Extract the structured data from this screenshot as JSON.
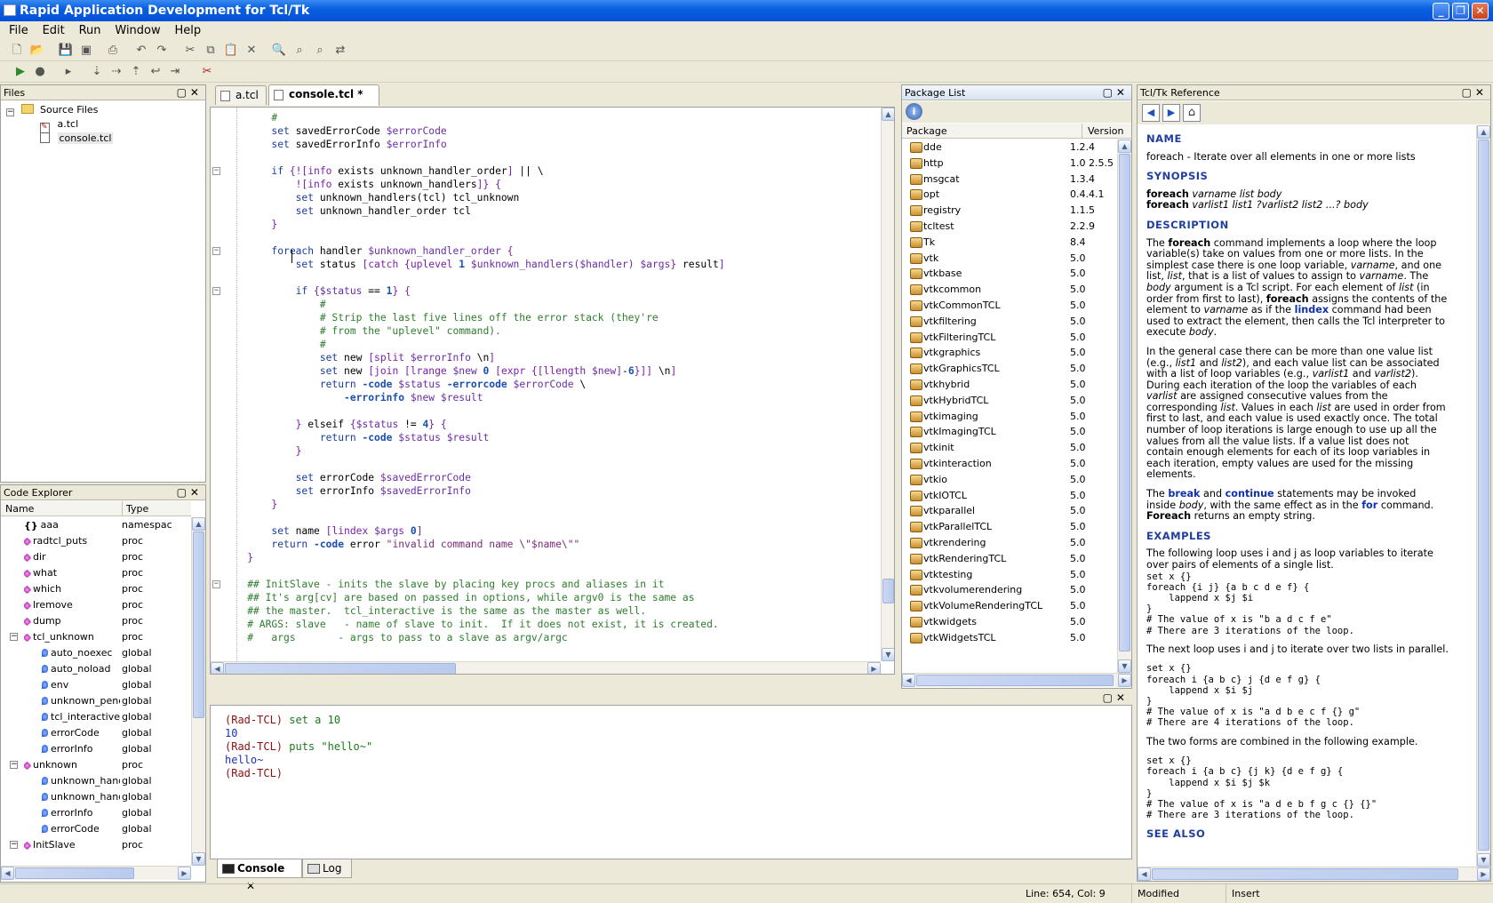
{
  "window": {
    "title": "Rapid Application Development for Tcl/Tk"
  },
  "menu": [
    "File",
    "Edit",
    "Run",
    "Window",
    "Help"
  ],
  "files_panel": {
    "title": "Files",
    "root": "Source Files",
    "items": [
      "a.tcl",
      "console.tcl"
    ]
  },
  "code_explorer": {
    "title": "Code Explorer",
    "columns": [
      "Name",
      "Type"
    ],
    "rows": [
      {
        "name": "aaa",
        "type": "namespac",
        "kind": "ns",
        "level": 0
      },
      {
        "name": "radtcl_puts",
        "type": "proc",
        "kind": "proc",
        "level": 0
      },
      {
        "name": "dir",
        "type": "proc",
        "kind": "proc",
        "level": 0
      },
      {
        "name": "what",
        "type": "proc",
        "kind": "proc",
        "level": 0
      },
      {
        "name": "which",
        "type": "proc",
        "kind": "proc",
        "level": 0
      },
      {
        "name": "lremove",
        "type": "proc",
        "kind": "proc",
        "level": 0
      },
      {
        "name": "dump",
        "type": "proc",
        "kind": "proc",
        "level": 0
      },
      {
        "name": "tcl_unknown",
        "type": "proc",
        "kind": "proc",
        "level": 0,
        "expanded": true
      },
      {
        "name": "auto_noexec",
        "type": "global",
        "kind": "glob",
        "level": 1
      },
      {
        "name": "auto_noload",
        "type": "global",
        "kind": "glob",
        "level": 1
      },
      {
        "name": "env",
        "type": "global",
        "kind": "glob",
        "level": 1
      },
      {
        "name": "unknown_pending",
        "type": "global",
        "kind": "glob",
        "level": 1
      },
      {
        "name": "tcl_interactive",
        "type": "global",
        "kind": "glob",
        "level": 1
      },
      {
        "name": "errorCode",
        "type": "global",
        "kind": "glob",
        "level": 1
      },
      {
        "name": "errorInfo",
        "type": "global",
        "kind": "glob",
        "level": 1
      },
      {
        "name": "unknown",
        "type": "proc",
        "kind": "proc",
        "level": 0,
        "expanded": true
      },
      {
        "name": "unknown_handlers",
        "type": "global",
        "kind": "glob",
        "level": 1
      },
      {
        "name": "unknown_handler_order",
        "type": "global",
        "kind": "glob",
        "level": 1
      },
      {
        "name": "errorInfo",
        "type": "global",
        "kind": "glob",
        "level": 1
      },
      {
        "name": "errorCode",
        "type": "global",
        "kind": "glob",
        "level": 1
      },
      {
        "name": "InitSlave",
        "type": "proc",
        "kind": "proc",
        "level": 0,
        "expanded": true
      }
    ]
  },
  "editor": {
    "tabs": [
      {
        "label": "a.tcl",
        "active": false
      },
      {
        "label": "console.tcl *",
        "active": true
      }
    ],
    "lines": [
      {
        "t": [
          [
            "",
            "        #"
          ]
        ],
        "cm": true
      },
      {
        "t": [
          [
            "kw",
            "        set"
          ],
          [
            "",
            " savedErrorCode "
          ],
          [
            "var",
            "$errorCode"
          ]
        ]
      },
      {
        "t": [
          [
            "kw",
            "        set"
          ],
          [
            "",
            " savedErrorInfo "
          ],
          [
            "var",
            "$errorInfo"
          ]
        ]
      },
      {
        "t": [
          [
            "",
            ""
          ]
        ]
      },
      {
        "t": [
          [
            "kw",
            "        if"
          ],
          [
            "",
            " "
          ],
          [
            "br",
            "{![info"
          ],
          [
            "",
            " exists unknown_handler_order"
          ],
          [
            "br",
            "]"
          ],
          [
            "",
            " || \\"
          ]
        ],
        "fold": true
      },
      {
        "t": [
          [
            "br",
            "            ![info"
          ],
          [
            "",
            " exists unknown_handlers"
          ],
          [
            "br",
            "]}"
          ],
          [
            "",
            " "
          ],
          [
            "br",
            "{"
          ]
        ]
      },
      {
        "t": [
          [
            "kw",
            "            set"
          ],
          [
            "",
            " unknown_handlers(tcl) tcl_unknown"
          ]
        ]
      },
      {
        "t": [
          [
            "kw",
            "            set"
          ],
          [
            "",
            " unknown_handler_order tcl"
          ]
        ]
      },
      {
        "t": [
          [
            "br",
            "        }"
          ]
        ]
      },
      {
        "t": [
          [
            "",
            ""
          ]
        ]
      },
      {
        "t": [
          [
            "kw",
            "        foreach"
          ],
          [
            "",
            " handler "
          ],
          [
            "var",
            "$unknown_handler_order"
          ],
          [
            "",
            " "
          ],
          [
            "br",
            "{"
          ]
        ],
        "fold": true
      },
      {
        "t": [
          [
            "kw",
            "            set"
          ],
          [
            "",
            " status "
          ],
          [
            "br",
            "[catch {uplevel"
          ],
          [
            "",
            " "
          ],
          [
            "sw",
            "1"
          ],
          [
            "",
            " "
          ],
          [
            "var",
            "$unknown_handlers($handler)"
          ],
          [
            "",
            " "
          ],
          [
            "var",
            "$args"
          ],
          [
            "br",
            "}"
          ],
          [
            "",
            " result"
          ],
          [
            "br",
            "]"
          ]
        ]
      },
      {
        "t": [
          [
            "",
            ""
          ]
        ]
      },
      {
        "t": [
          [
            "kw",
            "            if"
          ],
          [
            "",
            " "
          ],
          [
            "br",
            "{"
          ],
          [
            "var",
            "$status"
          ],
          [
            "",
            " == "
          ],
          [
            "sw",
            "1"
          ],
          [
            "br",
            "}"
          ],
          [
            "",
            " "
          ],
          [
            "br",
            "{"
          ]
        ],
        "fold": true
      },
      {
        "t": [
          [
            "cm",
            "                #"
          ]
        ]
      },
      {
        "t": [
          [
            "cm",
            "                # Strip the last five lines off the error stack (they're"
          ]
        ]
      },
      {
        "t": [
          [
            "cm",
            "                # from the \"uplevel\" command)."
          ]
        ]
      },
      {
        "t": [
          [
            "cm",
            "                #"
          ]
        ]
      },
      {
        "t": [
          [
            "kw",
            "                set"
          ],
          [
            "",
            " new "
          ],
          [
            "br",
            "[split"
          ],
          [
            "",
            " "
          ],
          [
            "var",
            "$errorInfo"
          ],
          [
            "",
            " \\n"
          ],
          [
            "br",
            "]"
          ]
        ]
      },
      {
        "t": [
          [
            "kw",
            "                set"
          ],
          [
            "",
            " new "
          ],
          [
            "br",
            "[join [lrange"
          ],
          [
            "",
            " "
          ],
          [
            "var",
            "$new"
          ],
          [
            "",
            " "
          ],
          [
            "sw",
            "0"
          ],
          [
            "",
            " "
          ],
          [
            "br",
            "[expr {[llength"
          ],
          [
            "",
            " "
          ],
          [
            "var",
            "$new"
          ],
          [
            "br",
            "]"
          ],
          [
            "",
            "-"
          ],
          [
            "sw",
            "6"
          ],
          [
            "br",
            "}]]"
          ],
          [
            "",
            " \\n"
          ],
          [
            "br",
            "]"
          ]
        ]
      },
      {
        "t": [
          [
            "kw",
            "                return"
          ],
          [
            "",
            " "
          ],
          [
            "sw",
            "-code"
          ],
          [
            "",
            " "
          ],
          [
            "var",
            "$status"
          ],
          [
            "",
            " "
          ],
          [
            "sw",
            "-errorcode"
          ],
          [
            "",
            " "
          ],
          [
            "var",
            "$errorCode"
          ],
          [
            "",
            " \\"
          ]
        ]
      },
      {
        "t": [
          [
            "sw",
            "                    -errorinfo"
          ],
          [
            "",
            " "
          ],
          [
            "var",
            "$new"
          ],
          [
            "",
            " "
          ],
          [
            "var",
            "$result"
          ]
        ]
      },
      {
        "t": [
          [
            "",
            ""
          ]
        ]
      },
      {
        "t": [
          [
            "br",
            "            }"
          ],
          [
            "",
            " elseif "
          ],
          [
            "br",
            "{"
          ],
          [
            "var",
            "$status"
          ],
          [
            "",
            " != "
          ],
          [
            "sw",
            "4"
          ],
          [
            "br",
            "}"
          ],
          [
            "",
            " "
          ],
          [
            "br",
            "{"
          ]
        ]
      },
      {
        "t": [
          [
            "kw",
            "                return"
          ],
          [
            "",
            " "
          ],
          [
            "sw",
            "-code"
          ],
          [
            "",
            " "
          ],
          [
            "var",
            "$status"
          ],
          [
            "",
            " "
          ],
          [
            "var",
            "$result"
          ]
        ]
      },
      {
        "t": [
          [
            "br",
            "            }"
          ]
        ]
      },
      {
        "t": [
          [
            "",
            ""
          ]
        ]
      },
      {
        "t": [
          [
            "kw",
            "            set"
          ],
          [
            "",
            " errorCode "
          ],
          [
            "var",
            "$savedErrorCode"
          ]
        ]
      },
      {
        "t": [
          [
            "kw",
            "            set"
          ],
          [
            "",
            " errorInfo "
          ],
          [
            "var",
            "$savedErrorInfo"
          ]
        ]
      },
      {
        "t": [
          [
            "br",
            "        }"
          ]
        ]
      },
      {
        "t": [
          [
            "",
            ""
          ]
        ]
      },
      {
        "t": [
          [
            "kw",
            "        set"
          ],
          [
            "",
            " name "
          ],
          [
            "br",
            "[lindex"
          ],
          [
            "",
            " "
          ],
          [
            "var",
            "$args"
          ],
          [
            "",
            " "
          ],
          [
            "sw",
            "0"
          ],
          [
            "br",
            "]"
          ]
        ]
      },
      {
        "t": [
          [
            "kw",
            "        return"
          ],
          [
            "",
            " "
          ],
          [
            "sw",
            "-code"
          ],
          [
            "",
            " error "
          ],
          [
            "str",
            "\"invalid command name \\\"$name\\\"\""
          ]
        ]
      },
      {
        "t": [
          [
            "br",
            "    }"
          ]
        ]
      },
      {
        "t": [
          [
            "",
            ""
          ]
        ]
      },
      {
        "t": [
          [
            "cm",
            "    ## InitSlave - inits the slave by placing key procs and aliases in it"
          ]
        ],
        "fold": true
      },
      {
        "t": [
          [
            "cm",
            "    ## It's arg[cv] are based on passed in options, while argv0 is the same as"
          ]
        ]
      },
      {
        "t": [
          [
            "cm",
            "    ## the master.  tcl_interactive is the same as the master as well."
          ]
        ]
      },
      {
        "t": [
          [
            "cm",
            "    # ARGS: slave   - name of slave to init.  If it does not exist, it is created."
          ]
        ]
      },
      {
        "t": [
          [
            "cm",
            "    #   args       - args to pass to a slave as argv/argc"
          ]
        ]
      }
    ]
  },
  "package_list": {
    "title": "Package List",
    "columns": [
      "Package",
      "Version"
    ],
    "rows": [
      {
        "name": "dde",
        "version": "1.2.4"
      },
      {
        "name": "http",
        "version": "1.0 2.5.5"
      },
      {
        "name": "msgcat",
        "version": "1.3.4"
      },
      {
        "name": "opt",
        "version": "0.4.4.1"
      },
      {
        "name": "registry",
        "version": "1.1.5"
      },
      {
        "name": "tcltest",
        "version": "2.2.9"
      },
      {
        "name": "Tk",
        "version": "8.4"
      },
      {
        "name": "vtk",
        "version": "5.0"
      },
      {
        "name": "vtkbase",
        "version": "5.0"
      },
      {
        "name": "vtkcommon",
        "version": "5.0"
      },
      {
        "name": "vtkCommonTCL",
        "version": "5.0"
      },
      {
        "name": "vtkfiltering",
        "version": "5.0"
      },
      {
        "name": "vtkFilteringTCL",
        "version": "5.0"
      },
      {
        "name": "vtkgraphics",
        "version": "5.0"
      },
      {
        "name": "vtkGraphicsTCL",
        "version": "5.0"
      },
      {
        "name": "vtkhybrid",
        "version": "5.0"
      },
      {
        "name": "vtkHybridTCL",
        "version": "5.0"
      },
      {
        "name": "vtkimaging",
        "version": "5.0"
      },
      {
        "name": "vtkImagingTCL",
        "version": "5.0"
      },
      {
        "name": "vtkinit",
        "version": "5.0"
      },
      {
        "name": "vtkinteraction",
        "version": "5.0"
      },
      {
        "name": "vtkio",
        "version": "5.0"
      },
      {
        "name": "vtkIOTCL",
        "version": "5.0"
      },
      {
        "name": "vtkparallel",
        "version": "5.0"
      },
      {
        "name": "vtkParallelTCL",
        "version": "5.0"
      },
      {
        "name": "vtkrendering",
        "version": "5.0"
      },
      {
        "name": "vtkRenderingTCL",
        "version": "5.0"
      },
      {
        "name": "vtktesting",
        "version": "5.0"
      },
      {
        "name": "vtkvolumerendering",
        "version": "5.0"
      },
      {
        "name": "vtkVolumeRenderingTCL",
        "version": "5.0"
      },
      {
        "name": "vtkwidgets",
        "version": "5.0"
      },
      {
        "name": "vtkWidgetsTCL",
        "version": "5.0"
      }
    ]
  },
  "reference": {
    "title": "Tcl/Tk Reference",
    "name_heading": "NAME",
    "name_text": "foreach - Iterate over all elements in one or more lists",
    "synopsis_heading": "SYNOPSIS",
    "syn1_cmd": "foreach",
    "syn1_args": "varname list body",
    "syn2_cmd": "foreach",
    "syn2_args": "varlist1 list1 ?varlist2 list2 ...? body",
    "description_heading": "DESCRIPTION",
    "examples_heading": "EXAMPLES",
    "see_also_heading": "SEE ALSO",
    "ex_intro1": "The following loop uses i and j as loop variables to iterate over pairs of elements of a single list.",
    "ex_code1": "set x {}\nforeach {i j} {a b c d e f} {\n    lappend x $j $i\n}\n# The value of x is \"b a d c f e\"\n# There are 3 iterations of the loop.",
    "ex_intro2": "The next loop uses i and j to iterate over two lists in parallel.",
    "ex_code2": "set x {}\nforeach i {a b c} j {d e f g} {\n    lappend x $i $j\n}\n# The value of x is \"a d b e c f {} g\"\n# There are 4 iterations of the loop.",
    "ex_intro3": "The two forms are combined in the following example.",
    "ex_code3": "set x {}\nforeach i {a b c} {j k} {d e f g} {\n    lappend x $i $j $k\n}\n# The value of x is \"a d e b f g c {} {}\"\n# There are 3 iterations of the loop."
  },
  "console": {
    "lines": [
      {
        "prompt": "(Rad-TCL)",
        "input": " set a 10"
      },
      {
        "output": "10"
      },
      {
        "prompt": "(Rad-TCL)",
        "input": " puts \"hello~\""
      },
      {
        "output": "hello~"
      },
      {
        "prompt": "(Rad-TCL)",
        "input": ""
      }
    ],
    "tabs": [
      "Console",
      "Log"
    ]
  },
  "status": {
    "position": "Line: 654, Col:  9",
    "modified": "Modified",
    "mode": "Insert"
  }
}
